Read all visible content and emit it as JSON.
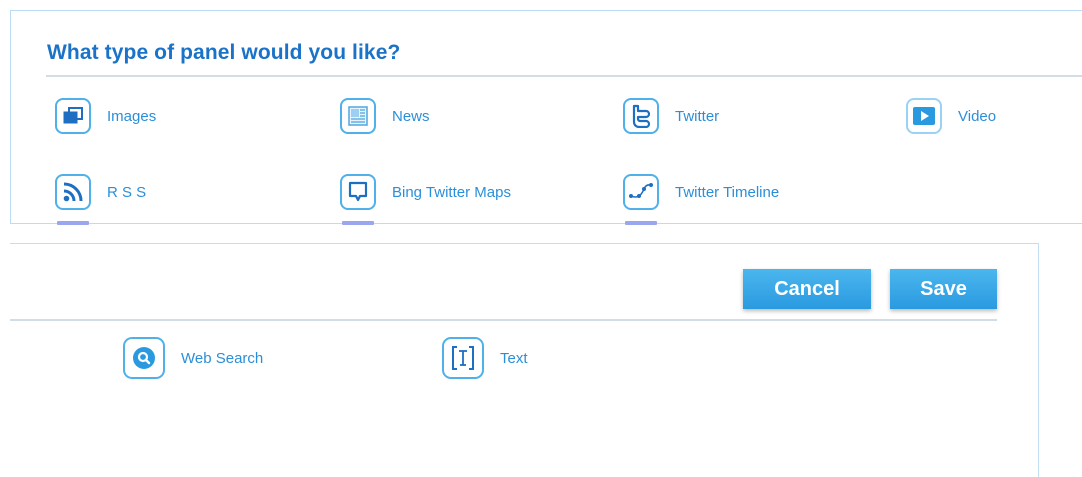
{
  "dialog": {
    "title": "What type of panel would you like?"
  },
  "panel_types": [
    {
      "label": "Images",
      "icon": "images-icon"
    },
    {
      "label": "News",
      "icon": "news-icon"
    },
    {
      "label": "Twitter",
      "icon": "twitter-icon"
    },
    {
      "label": "Video",
      "icon": "video-icon"
    },
    {
      "label": "R S S",
      "icon": "rss-icon"
    },
    {
      "label": "Bing Twitter Maps",
      "icon": "map-pin-icon"
    },
    {
      "label": "Twitter Timeline",
      "icon": "timeline-icon"
    },
    {
      "label": "Web Search",
      "icon": "search-icon"
    },
    {
      "label": "Text",
      "icon": "text-icon"
    }
  ],
  "actions": {
    "cancel_label": "Cancel",
    "save_label": "Save"
  },
  "colors": {
    "accent": "#2a9ae0",
    "title": "#1a73c8",
    "label": "#2a8fd9",
    "tab_underline": "#9aa6ee"
  }
}
